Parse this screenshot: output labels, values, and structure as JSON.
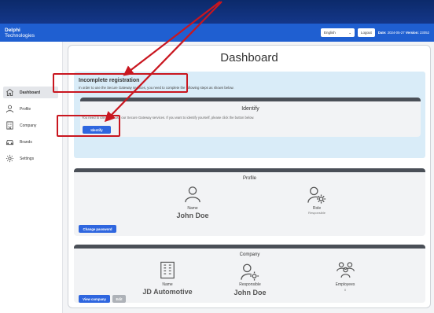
{
  "header": {
    "brand_line1": "Delphi",
    "brand_line2": "Technologies",
    "language": "English",
    "logout_label": "Logout",
    "date_label": "Date:",
    "date_value": "2024-05-27",
    "version_label": "Version:",
    "version_value": "23052"
  },
  "sidebar": {
    "items": [
      {
        "label": "Dashboard",
        "icon": "home-icon",
        "active": true
      },
      {
        "label": "Profile",
        "icon": "person-icon",
        "active": false
      },
      {
        "label": "Company",
        "icon": "building-icon",
        "active": false
      },
      {
        "label": "Brands",
        "icon": "car-icon",
        "active": false
      },
      {
        "label": "Settings",
        "icon": "gear-icon",
        "active": false
      }
    ]
  },
  "main": {
    "title": "Dashboard",
    "registration": {
      "title": "Incomplete registration",
      "description": "In order to use the Secure Gateway services, you need to complete the following steps as shown below.",
      "identify": {
        "title": "Identify",
        "description": "You need to identify to use our Secure Gateway services. If you want to identify yourself, please click the button below.",
        "button_label": "Identify"
      }
    },
    "profile": {
      "title": "Profile",
      "name_label": "Name",
      "name_value": "John Doe",
      "role_label": "Role",
      "role_value": "Responsible",
      "button_label": "Change password"
    },
    "company": {
      "title": "Company",
      "name_label": "Name",
      "name_value": "JD Automotive",
      "responsible_label": "Responsible",
      "responsible_value": "John Doe",
      "employees_label": "Employees",
      "employees_value": "0",
      "view_button_label": "View company",
      "edit_button_label": "Edit"
    }
  },
  "colors": {
    "header_blue": "#1f5fd1",
    "button_blue": "#2f66df",
    "callout_red": "#c9161f",
    "info_bg": "#d9ecf8"
  }
}
